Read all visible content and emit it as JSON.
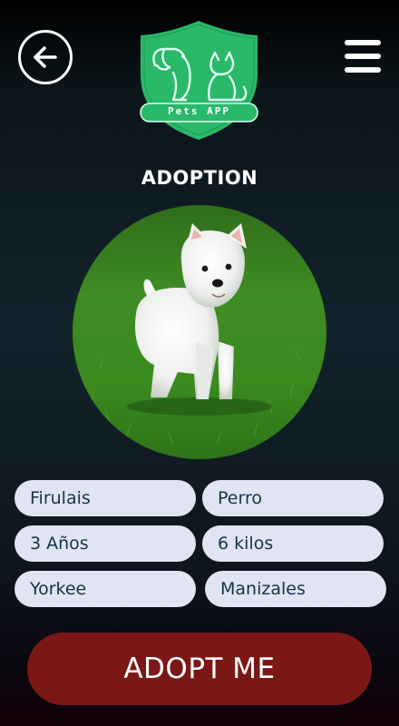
{
  "header": {
    "back_icon": "arrow-left-icon",
    "menu_icon": "hamburger-menu-icon",
    "logo_text": "Pets APP",
    "logo_color": "#2ab86a"
  },
  "page": {
    "title": "ADOPTION",
    "photo": "white-terrier-on-grass"
  },
  "pet": {
    "name": "Firulais",
    "species": "Perro",
    "age": "3 Años",
    "weight": "6 kilos",
    "breed": "Yorkee",
    "city": "Manizales"
  },
  "actions": {
    "adopt_label": "ADOPT ME",
    "adopt_color": "#7b1816"
  },
  "colors": {
    "pill_bg": "#e1e5f3",
    "pill_text": "#15324a"
  }
}
